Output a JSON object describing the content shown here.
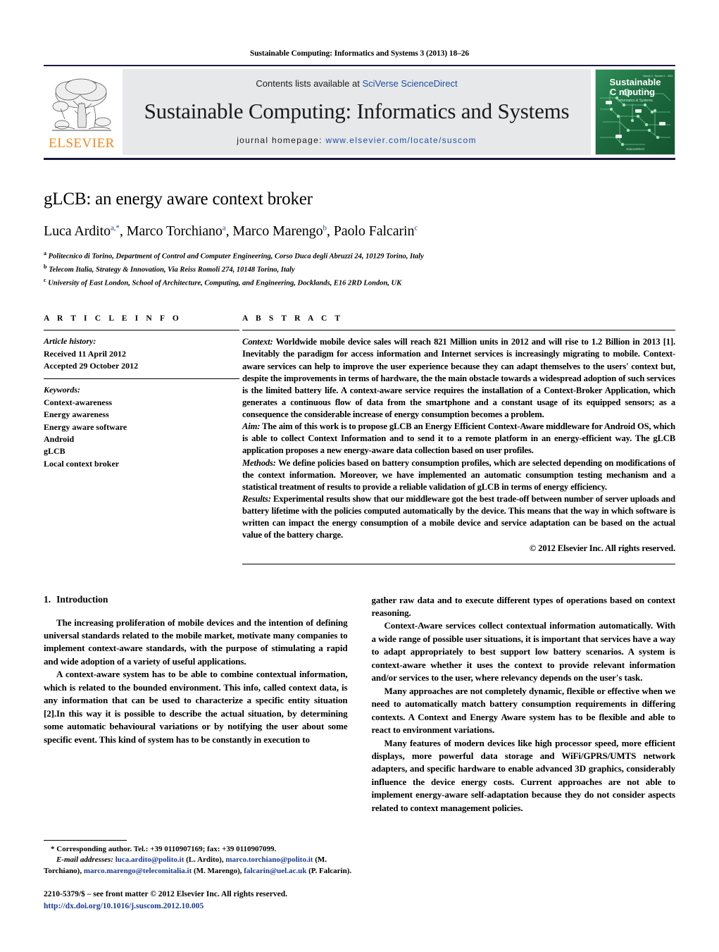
{
  "running_head": "Sustainable Computing: Informatics and Systems 3 (2013) 18–26",
  "masthead": {
    "publisher_name": "ELSEVIER",
    "contents_prefix": "Contents lists available at ",
    "contents_link": "SciVerse ScienceDirect",
    "journal_title": "Sustainable Computing: Informatics and Systems",
    "homepage_prefix": "journal homepage: ",
    "homepage_url": "www.elsevier.com/locate/suscom",
    "cover": {
      "line1": "Sustainable",
      "line2": "C",
      "line2b": "mputing",
      "subtitle": "Informatics & Systems",
      "corner_text": "Volume 3 · Number 1 · 2013",
      "bottom_text": "ScienceDirect"
    }
  },
  "title": "gLCB: an energy aware context broker",
  "authors": [
    {
      "name": "Luca Ardito",
      "marks": "a,*"
    },
    {
      "name": "Marco Torchiano",
      "marks": "a"
    },
    {
      "name": "Marco Marengo",
      "marks": "b"
    },
    {
      "name": "Paolo Falcarin",
      "marks": "c"
    }
  ],
  "affiliations": [
    {
      "mark": "a",
      "text": "Politecnico di Torino, Department of Control and Computer Engineering, Corso Duca degli Abruzzi 24, 10129 Torino, Italy"
    },
    {
      "mark": "b",
      "text": "Telecom Italia, Strategy & Innovation, Via Reiss Romoli 274, 10148 Torino, Italy"
    },
    {
      "mark": "c",
      "text": "University of East London, School of Architecture, Computing, and Engineering, Docklands, E16 2RD London, UK"
    }
  ],
  "article_info": {
    "heading": "A R T I C L E   I N F O",
    "history_label": "Article history:",
    "history": [
      "Received 11 April 2012",
      "Accepted 29 October 2012"
    ],
    "keywords_label": "Keywords:",
    "keywords": [
      "Context-awareness",
      "Energy awareness",
      "Energy aware software",
      "Android",
      "gLCB",
      "Local context broker"
    ]
  },
  "abstract": {
    "heading": "A B S T R A C T",
    "paragraphs": [
      {
        "lead": "Context:",
        "text": " Worldwide mobile device sales will reach 821 Million units in 2012 and will rise to 1.2 Billion in 2013 [1]. Inevitably the paradigm for access information and Internet services is increasingly migrating to mobile. Context-aware services can help to improve the user experience because they can adapt themselves to the users' context but, despite the improvements in terms of hardware, the the main obstacle towards a widespread adoption of such services is the limited battery life. A context-aware service requires the installation of a Context-Broker Application, which generates a continuous flow of data from the smartphone and a constant usage of its equipped sensors; as a consequence the considerable increase of energy consumption becomes a problem."
      },
      {
        "lead": "Aim:",
        "text": " The aim of this work is to propose gLCB an Energy Efficient Context-Aware middleware for Android OS, which is able to collect Context Information and to send it to a remote platform in an energy-efficient way. The gLCB application proposes a new energy-aware data collection based on user profiles."
      },
      {
        "lead": "Methods:",
        "text": " We define policies based on battery consumption profiles, which are selected depending on modifications of the context information. Moreover, we have implemented an automatic consumption testing mechanism and a statistical treatment of results to provide a reliable validation of gLCB in terms of energy efficiency."
      },
      {
        "lead": "Results:",
        "text": " Experimental results show that our middleware got the best trade-off between number of server uploads and battery lifetime with the policies computed automatically by the device. This means that the way in which software is written can impact the energy consumption of a mobile device and service adaptation can be based on the actual value of the battery charge."
      }
    ],
    "copyright": "© 2012 Elsevier Inc. All rights reserved."
  },
  "introduction": {
    "number": "1.",
    "title": "Introduction",
    "left_paragraphs": [
      "The increasing proliferation of mobile devices and the intention of defining universal standards related to the mobile market, motivate many companies to implement context-aware standards, with the purpose of stimulating a rapid and wide adoption of a variety of useful applications.",
      "A context-aware system has to be able to combine contextual information, which is related to the bounded environment. This info, called context data, is any information that can be used to characterize a specific entity situation [2].In this way it is possible to describe the actual situation, by determining some automatic behavioural variations or by notifying the user about some specific event. This kind of system has to be constantly in execution to"
    ],
    "right_paragraphs": [
      "gather raw data and to execute different types of operations based on context reasoning.",
      "Context-Aware services collect contextual information automatically. With a wide range of possible user situations, it is important that services have a way to adapt appropriately to best support low battery scenarios. A system is context-aware whether it uses the context to provide relevant information and/or services to the user, where relevancy depends on the user's task.",
      "Many approaches are not completely dynamic, flexible or effective when we need to automatically match battery consumption requirements in differing contexts. A Context and Energy Aware system has to be flexible and able to react to environment variations.",
      "Many features of modern devices like high processor speed, more efficient displays, more powerful data storage and WiFi/GPRS/UMTS network adapters, and specific hardware to enable advanced 3D graphics, considerably influence the device energy costs. Current approaches are not able to implement energy-aware self-adaptation because they do not consider aspects related to context management policies."
    ]
  },
  "footnotes": {
    "corresponding": "* Corresponding author. Tel.: +39 0110907169; fax: +39 0110907099.",
    "email_label": "E-mail addresses:",
    "emails": [
      {
        "address": "luca.ardito@polito.it",
        "owner": " (L. Ardito), "
      },
      {
        "address": "marco.torchiano@polito.it",
        "owner": " (M. Torchiano), "
      },
      {
        "address": "marco.marengo@telecomitalia.it",
        "owner": " (M. Marengo), "
      },
      {
        "address": "falcarin@uel.ac.uk",
        "owner": " (P. Falcarin)."
      }
    ],
    "issn_line": "2210-5379/$ – see front matter © 2012 Elsevier Inc. All rights reserved.",
    "doi": "http://dx.doi.org/10.1016/j.suscom.2012.10.005"
  },
  "colors": {
    "link_blue": "#1c4fa1",
    "elsevier_orange": "#f08a22",
    "rule_navy": "#1a1a3e",
    "band_gray": "#e7e8ea",
    "cover_green": "#1d6b3f"
  }
}
